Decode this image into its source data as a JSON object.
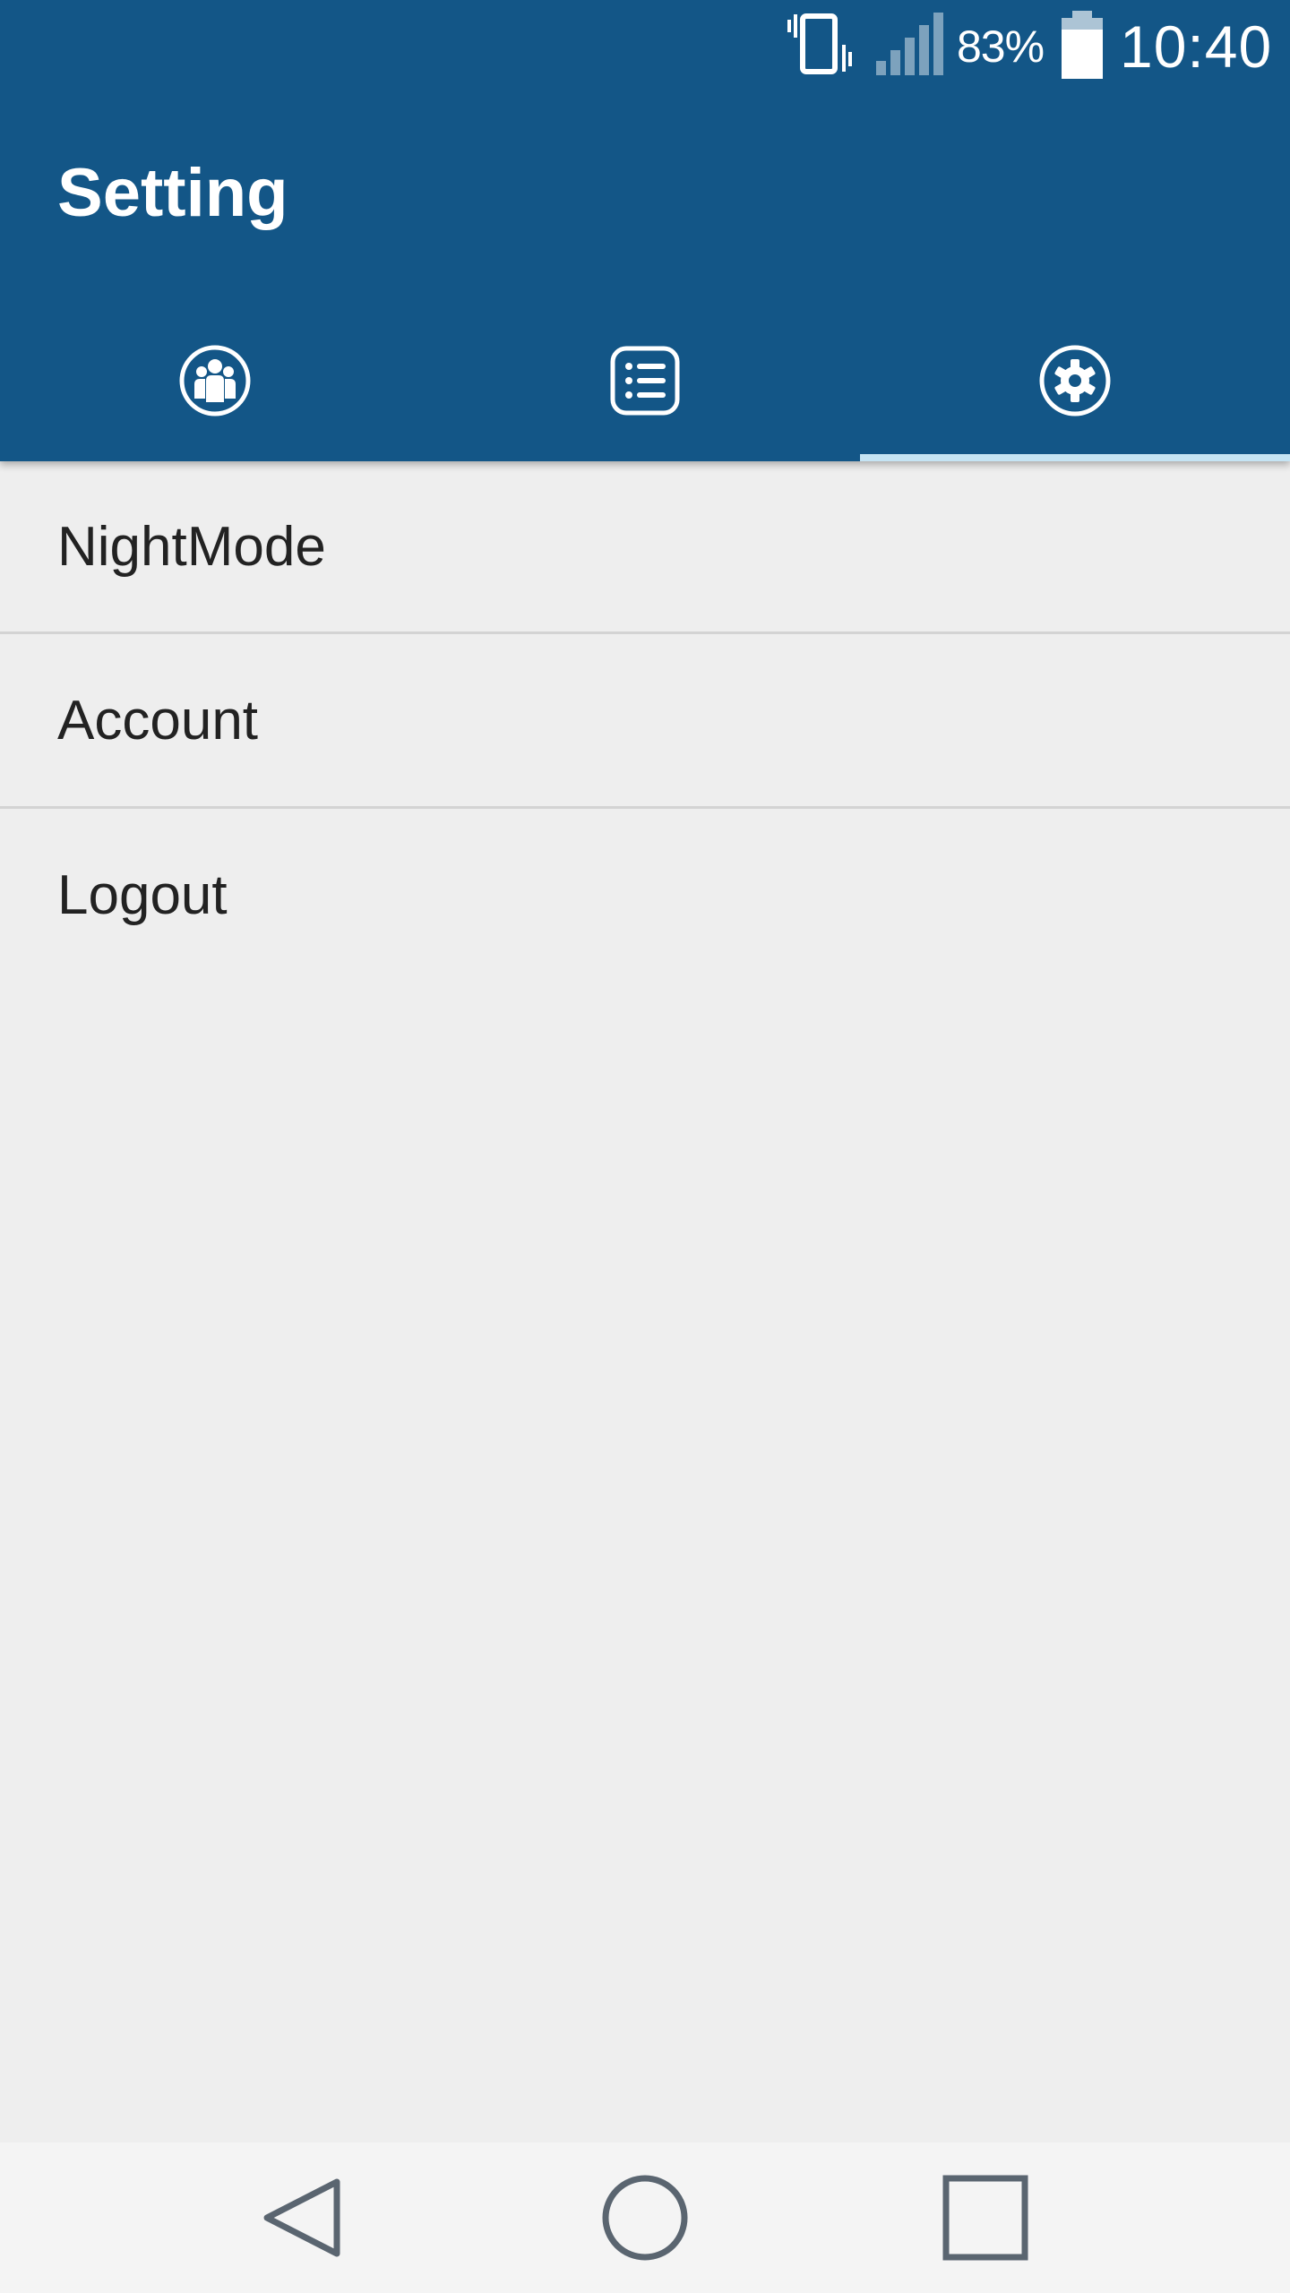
{
  "status_bar": {
    "battery_percent": "83%",
    "time": "10:40",
    "icons": [
      "vibrate-icon",
      "cell-signal-icon",
      "battery-icon"
    ]
  },
  "header": {
    "title": "Setting",
    "background_color": "#135687"
  },
  "tabs": [
    {
      "icon": "group-icon"
    },
    {
      "icon": "list-icon"
    },
    {
      "icon": "gear-icon",
      "selected": true
    }
  ],
  "tab_indicator_color": "#c5e4f4",
  "settings": {
    "items": [
      {
        "label": "NightMode"
      },
      {
        "label": "Account"
      },
      {
        "label": "Logout"
      }
    ]
  },
  "navigation": {
    "buttons": [
      "back-icon",
      "home-icon",
      "recents-icon"
    ]
  }
}
